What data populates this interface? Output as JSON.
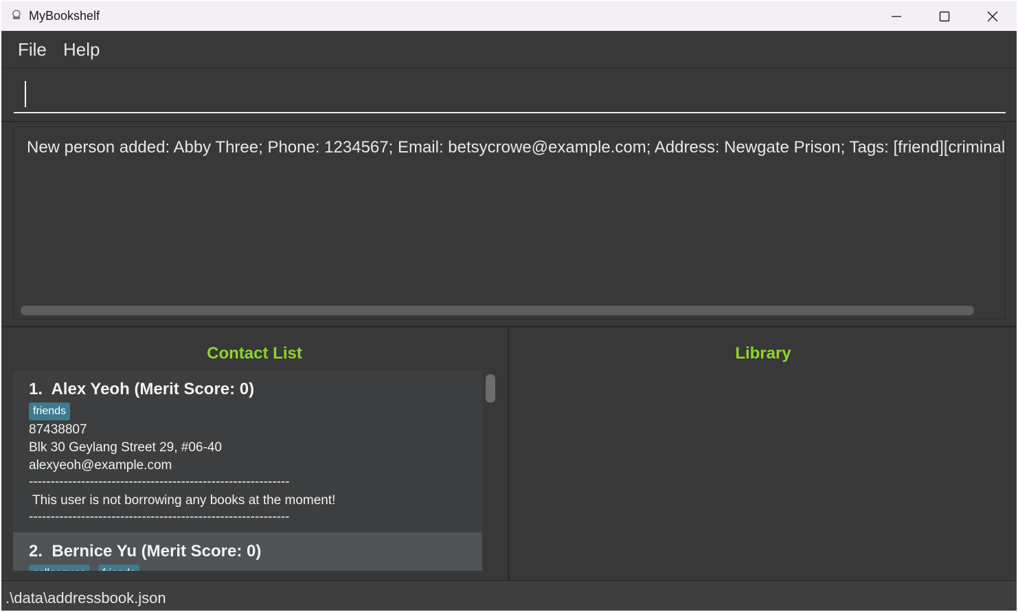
{
  "window": {
    "title": "MyBookshelf",
    "icon": "app-icon",
    "controls": {
      "minimize_icon": "minimize-icon",
      "maximize_icon": "maximize-icon",
      "close_icon": "close-icon"
    }
  },
  "menu": {
    "file_label": "File",
    "help_label": "Help"
  },
  "command": {
    "value": "",
    "placeholder": ""
  },
  "result": {
    "message": "New person added: Abby Three; Phone: 1234567; Email: betsycrowe@example.com; Address: Newgate Prison; Tags: [friend][criminal]"
  },
  "contact_list": {
    "title": "Contact List",
    "persons": [
      {
        "index": "1.",
        "name": "Alex Yeoh",
        "merit": "(Merit Score: 0)",
        "tags": [
          "friends"
        ],
        "phone": "87438807",
        "address": "Blk 30 Geylang Street 29, #06-40",
        "email": "alexyeoh@example.com",
        "separator_top": "------------------------------------------------------------",
        "borrow_status": "This user is not borrowing any books at the moment!",
        "separator_bottom": "------------------------------------------------------------"
      },
      {
        "index": "2.",
        "name": "Bernice Yu",
        "merit": "(Merit Score: 0)",
        "tags": [
          "colleagues",
          "friends"
        ]
      }
    ]
  },
  "library": {
    "title": "Library"
  },
  "status": {
    "file_path": ".\\data\\addressbook.json"
  },
  "colors": {
    "panel_title": "#8ad62b",
    "tag_bg": "#3e7b91",
    "background": "#383838"
  }
}
